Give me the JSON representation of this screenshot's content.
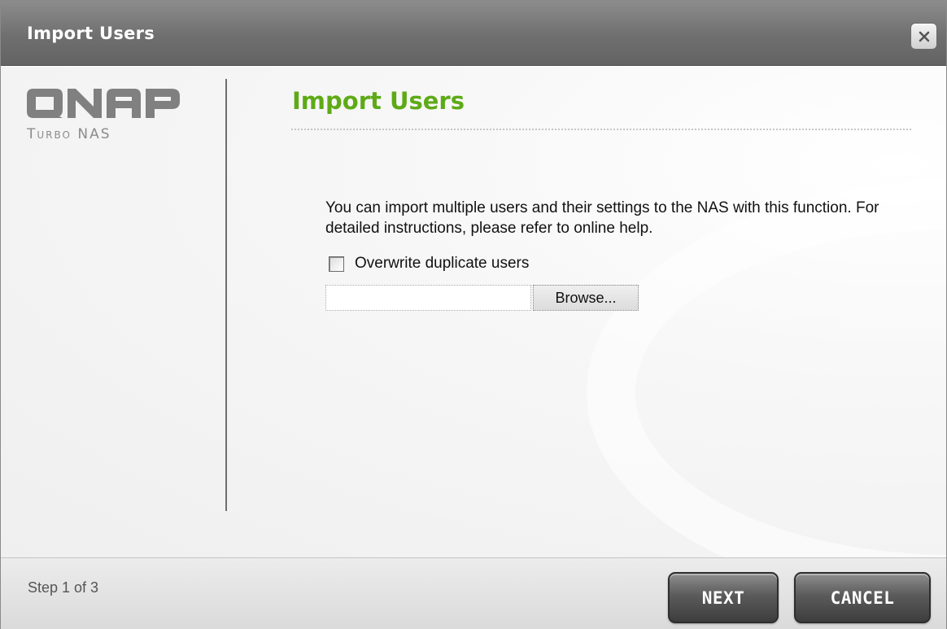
{
  "window": {
    "title": "Import Users",
    "close_icon": "close-icon"
  },
  "sidebar": {
    "logo_text": "QNAP",
    "logo_subtitle": "Turbo NAS"
  },
  "main": {
    "heading": "Import Users",
    "description": "You can import multiple users and their settings to the NAS with this function. For detailed instructions, please refer to online help.",
    "overwrite_label": "Overwrite duplicate users",
    "overwrite_checked": false,
    "file_input_value": "",
    "browse_label": "Browse..."
  },
  "footer": {
    "step_text": "Step 1 of 3",
    "next_label": "NEXT",
    "cancel_label": "CANCEL"
  },
  "colors": {
    "heading_green": "#5eaa16",
    "titlebar_gray": "#6f6f6f",
    "button_dark": "#3d3d3d"
  }
}
